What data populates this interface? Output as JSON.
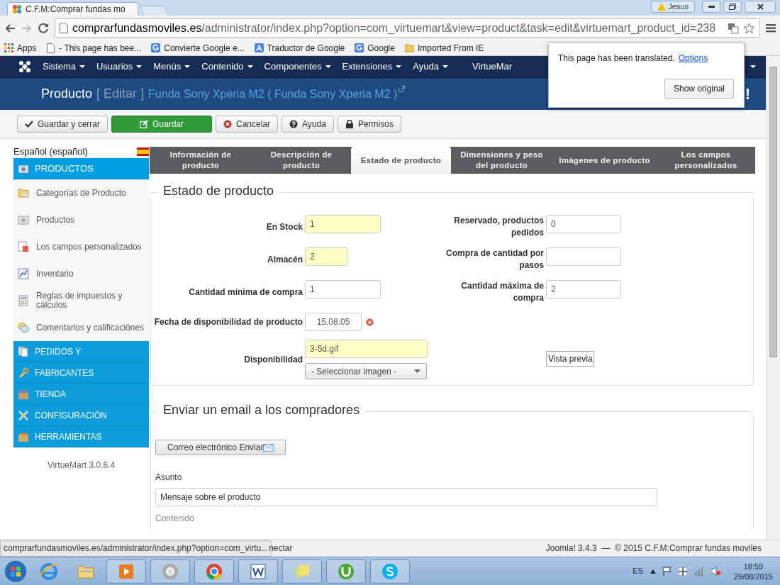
{
  "browser": {
    "tab_title": "C.F.M:Comprar fundas mo",
    "user": "Jesus",
    "url_host": "comprarfundasmoviles.es",
    "url_path": "/administrator/index.php?option=com_virtuemart&view=product&task=edit&virtuemart_product_id=238",
    "bookmarks": [
      {
        "label": "Apps",
        "kind": "apps"
      },
      {
        "label": "- This page has bee...",
        "kind": "page"
      },
      {
        "label": "Convierte Google e...",
        "kind": "google"
      },
      {
        "label": "Traductor de Google",
        "kind": "translate"
      },
      {
        "label": "Google",
        "kind": "google"
      },
      {
        "label": "Imported From IE",
        "kind": "folder"
      }
    ]
  },
  "translate_popup": {
    "message": "This page has been translated.",
    "link": "Options",
    "button": "Show original"
  },
  "menu": [
    "Sistema",
    "Usuarios",
    "Menús",
    "Contenido",
    "Componentes",
    "Extensiones",
    "Ayuda",
    "VirtueMar"
  ],
  "header": {
    "title": "Producto",
    "action": "[ Editar ]",
    "product": "Funda Sony Xperia M2 ( Funda Sony Xperia M2 )",
    "logo_tail": "!"
  },
  "toolbar": [
    {
      "label": "Guardar y cerrar",
      "kind": "check"
    },
    {
      "label": "Guardar",
      "kind": "edit"
    },
    {
      "label": "Cancelar",
      "kind": "cancel"
    },
    {
      "label": "Ayuda",
      "kind": "help"
    },
    {
      "label": "Permisos",
      "kind": "lock"
    }
  ],
  "sidebar": {
    "language": "Español (español)",
    "sections": [
      {
        "label": "PRODUCTOS",
        "kind": "products",
        "expanded": true,
        "children": [
          {
            "label": "Categorías de Producto",
            "kind": "folder"
          },
          {
            "label": "Productos",
            "kind": "camera"
          },
          {
            "label": "Los campos personalizados",
            "kind": "doc"
          },
          {
            "label": "Inventario",
            "kind": "chart"
          },
          {
            "label": "Reglas de impuestos y cálculos",
            "kind": "calc"
          },
          {
            "label": "Comentarios y calificaciónes",
            "kind": "chat"
          }
        ]
      },
      {
        "label": "PEDIDOS Y",
        "kind": "orders",
        "expanded": false
      },
      {
        "label": "FABRICANTES",
        "kind": "wrench",
        "expanded": false
      },
      {
        "label": "TIENDA",
        "kind": "shop",
        "expanded": false
      },
      {
        "label": "CONFIGURACIÓN",
        "kind": "tools",
        "expanded": false
      },
      {
        "label": "HERRAMIENTAS",
        "kind": "box",
        "expanded": false
      }
    ],
    "version": "VirtueMart 3.0.6.4"
  },
  "tabs": [
    {
      "label": "Información de producto",
      "selected": false
    },
    {
      "label": "Descripción de producto",
      "selected": false
    },
    {
      "label": "Estado de producto",
      "selected": true
    },
    {
      "label": "Dimensiones y peso del producto",
      "selected": false
    },
    {
      "label": "Imágenes de producto",
      "selected": false
    },
    {
      "label": "Los campos personalizados",
      "selected": false
    }
  ],
  "status_section": {
    "legend": "Estado de producto",
    "left_fields": [
      {
        "label": "En Stock",
        "value": "1",
        "kind": "text",
        "highlight": true
      },
      {
        "label": "Almacén",
        "value": "2",
        "kind": "short",
        "highlight": true
      },
      {
        "label": "Cantidad mínima de compra",
        "value": "1",
        "kind": "text",
        "highlight": false
      },
      {
        "label": "Fecha de disponibilidad de producto",
        "value": "15.08.05",
        "kind": "date",
        "highlight": false
      },
      {
        "label": "Disponibilidad",
        "value": "3-5d.gif",
        "kind": "image",
        "highlight": true,
        "select": "- Seleccionar imagen -"
      }
    ],
    "right_fields": [
      {
        "label": "Reservado, productos pedidos",
        "value": "0"
      },
      {
        "label": "Compra de cantidad por pasos"
      },
      {
        "label": "Cantidad máxima de compra",
        "value": "2"
      }
    ],
    "preview_button": "Vista previa"
  },
  "email_section": {
    "legend": "Enviar un email a los compradores",
    "send_button": "Correo electrónico Enviar",
    "subject_label": "Asunto",
    "subject_value": "Mensaje sobre el producto",
    "content_label": "Contenido"
  },
  "status_bar": {
    "link_preview": "comprarfundasmoviles.es/administrator/index.php?option=com_virtu...",
    "partial": "nectar",
    "footer": "Joomla! 3.4.3  —  © 2015 C.F.M:Comprar fundas moviles"
  },
  "taskbar": {
    "language": "ES",
    "time": "18:59",
    "date": "29/08/2015"
  }
}
